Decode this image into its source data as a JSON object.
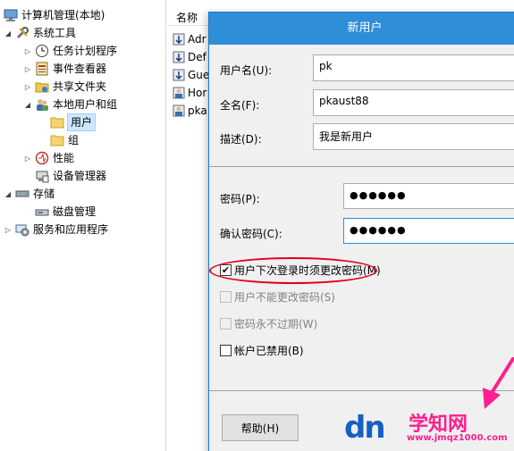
{
  "tree": {
    "root": "计算机管理(本地)",
    "system_tools": "系统工具",
    "task_scheduler": "任务计划程序",
    "event_viewer": "事件查看器",
    "shared_folders": "共享文件夹",
    "local_users_groups": "本地用户和组",
    "users": "用户",
    "groups": "组",
    "performance": "性能",
    "device_manager": "设备管理器",
    "storage": "存储",
    "disk_management": "磁盘管理",
    "services_apps": "服务和应用程序"
  },
  "list": {
    "header_name": "名称",
    "rows": [
      "Adr",
      "Def",
      "Gue",
      "Hor",
      "pka"
    ]
  },
  "dialog": {
    "title": "新用户",
    "username_label": "用户名(U):",
    "username_value": "pk",
    "fullname_label": "全名(F):",
    "fullname_value": "pkaust88",
    "description_label": "描述(D):",
    "description_value": "我是新用户",
    "password_label": "密码(P):",
    "password_value": "●●●●●●",
    "confirm_label": "确认密码(C):",
    "confirm_value": "●●●●●●",
    "cb_must_change": "用户下次登录时须更改密码(M)",
    "cb_cannot_change": "用户不能更改密码(S)",
    "cb_never_expires": "密码永不过期(W)",
    "cb_disabled": "帐户已禁用(B)",
    "help_button": "帮助(H)"
  },
  "watermark": {
    "logo": "dn",
    "site_name": "学知网",
    "url": "www.jmqz1000.com"
  },
  "colors": {
    "title_bar": "#2e8ed8",
    "highlight_ellipse": "#e0001b",
    "selection": "#cce8ff"
  }
}
